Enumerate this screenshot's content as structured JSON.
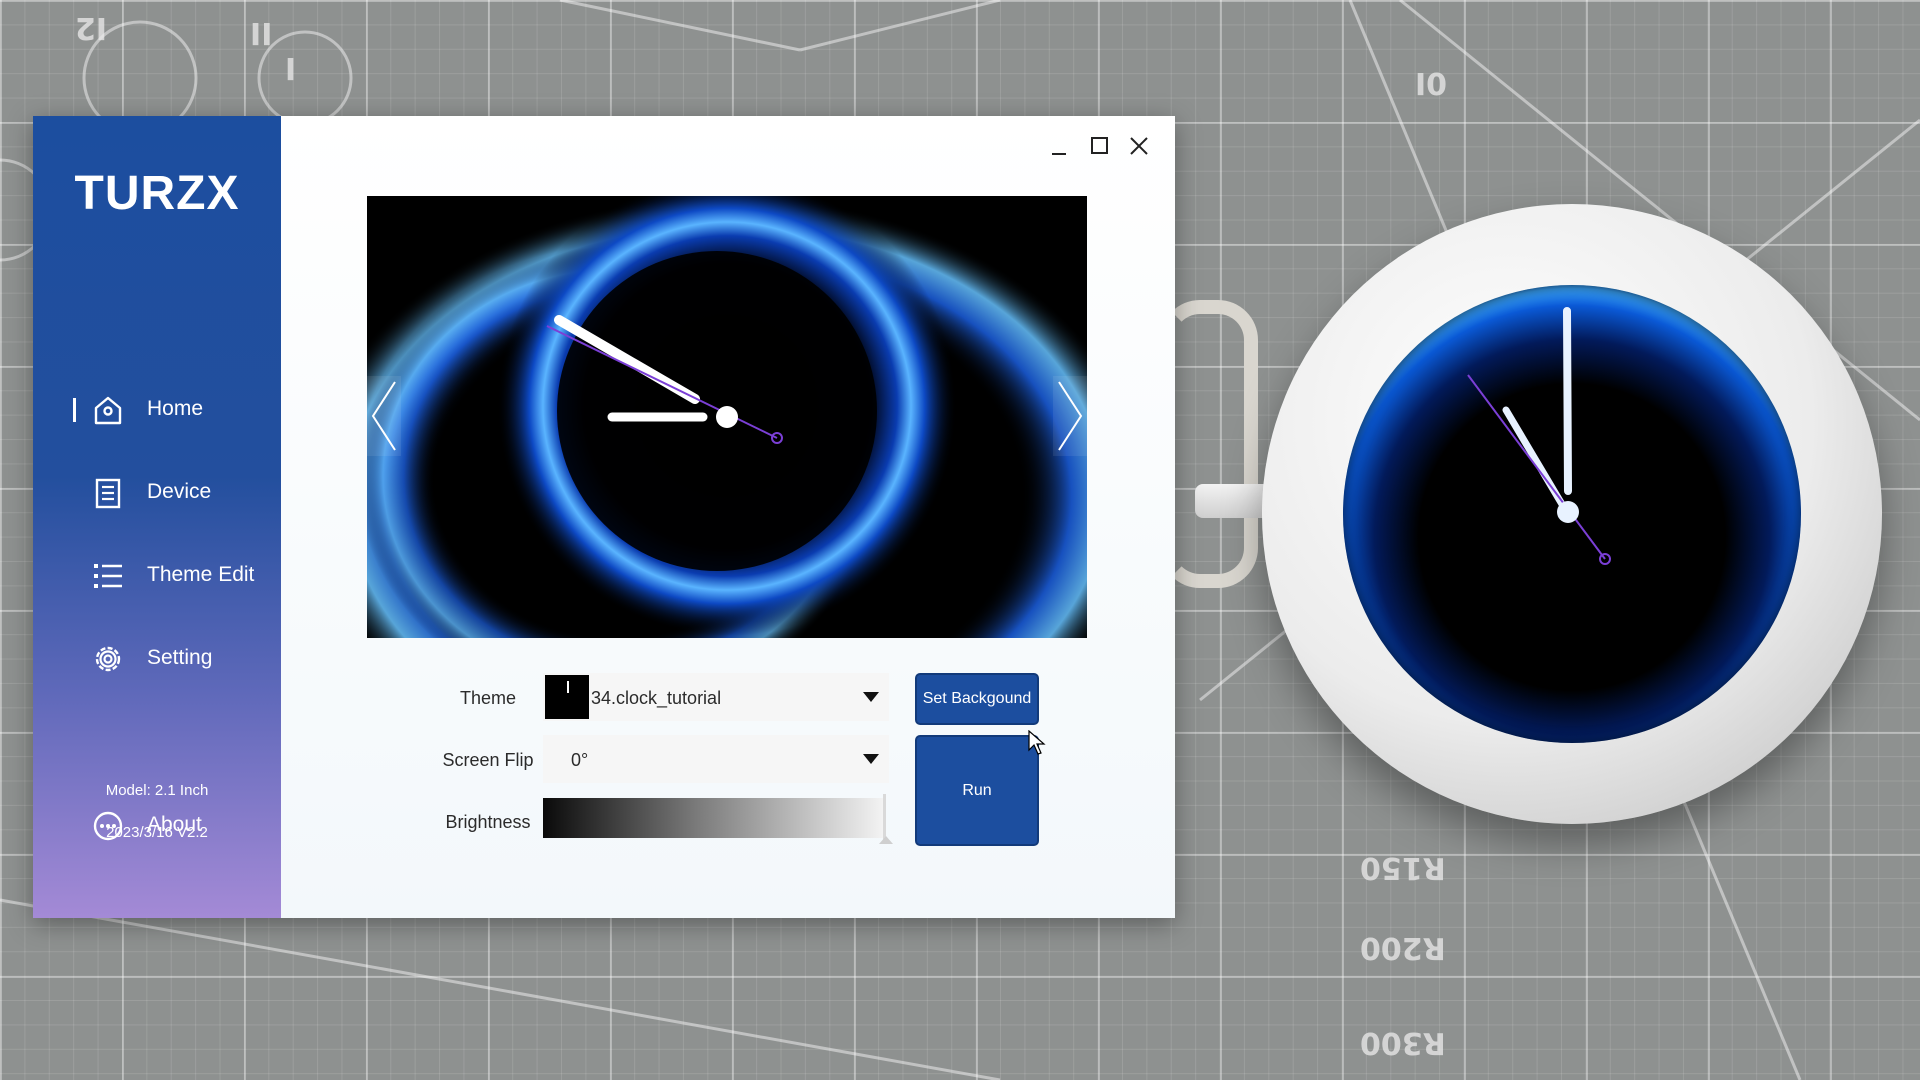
{
  "app": {
    "brand": "TURZX"
  },
  "sidebar": {
    "items": [
      {
        "label": "Home",
        "icon": "home-icon",
        "active": true
      },
      {
        "label": "Device",
        "icon": "document-icon",
        "active": false
      },
      {
        "label": "Theme Edit",
        "icon": "list-icon",
        "active": false
      },
      {
        "label": "Setting",
        "icon": "gear-icon",
        "active": false
      },
      {
        "label": "About",
        "icon": "more-circle-icon",
        "active": false
      }
    ],
    "model": "Model: 2.1 Inch",
    "version": "2023/3/16 V2.2"
  },
  "window_controls": [
    "minimize-icon",
    "maximize-icon",
    "close-icon"
  ],
  "form": {
    "theme_label": "Theme",
    "theme_value": "34.clock_tutorial",
    "flip_label": "Screen Flip",
    "flip_value": "0°",
    "brightness_label": "Brightness",
    "brightness_level": 1.0
  },
  "buttons": {
    "set_background": "Set Backgound",
    "run": "Run"
  },
  "mat_labels": [
    "R150",
    "R200",
    "R300",
    "I2",
    "II",
    "I",
    "0I"
  ],
  "colors": {
    "sidebar_top": "#1c4e9f",
    "sidebar_bottom": "#a48ad6",
    "button": "#1c4e9f",
    "glow_blue": "#2f8bff"
  }
}
